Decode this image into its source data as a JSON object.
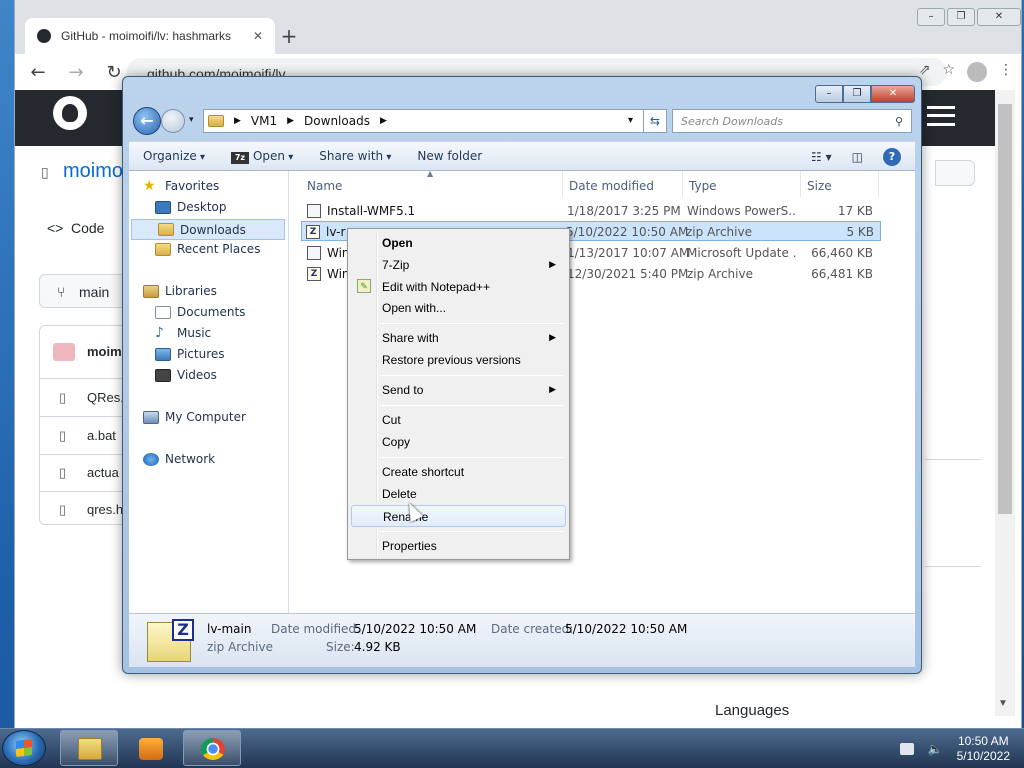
{
  "browser": {
    "tab_title": "GitHub - moimoifi/lv: hashmarks",
    "tab_close": "✕",
    "new_tab": "+",
    "url": "github.com/moimoifi/lv",
    "window_buttons": [
      "–",
      "❐",
      "✕"
    ]
  },
  "github": {
    "repo_owner": "moimo",
    "tab_code": "Code",
    "branch": "main",
    "commit_user": "moim",
    "files": [
      "QRes.",
      "a.bat",
      "actua",
      "qres.h"
    ],
    "languages": "Languages"
  },
  "explorer": {
    "window_buttons": [
      "–",
      "❐",
      "✕"
    ],
    "breadcrumb": [
      "VM1",
      "Downloads"
    ],
    "search_placeholder": "Search Downloads",
    "toolbar": {
      "organize": "Organize",
      "open": "Open",
      "open_icon": "7z",
      "share_with": "Share with",
      "new_folder": "New folder"
    },
    "nav": [
      {
        "label": "Favorites",
        "icon": "star"
      },
      {
        "label": "Desktop",
        "icon": "desk"
      },
      {
        "label": "Downloads",
        "icon": "fold",
        "selected": true
      },
      {
        "label": "Recent Places",
        "icon": "fold"
      },
      {
        "label": "Libraries",
        "icon": "lib"
      },
      {
        "label": "Documents",
        "icon": "doc"
      },
      {
        "label": "Music",
        "icon": "music"
      },
      {
        "label": "Pictures",
        "icon": "pic"
      },
      {
        "label": "Videos",
        "icon": "vid"
      },
      {
        "label": "My Computer",
        "icon": "comp"
      },
      {
        "label": "Network",
        "icon": "net"
      }
    ],
    "columns": [
      "Name",
      "Date modified",
      "Type",
      "Size"
    ],
    "files": [
      {
        "name": "Install-WMF5.1",
        "date": "1/18/2017 3:25 PM",
        "type": "Windows PowerS...",
        "size": "17 KB",
        "icon": "ps"
      },
      {
        "name": "lv-main",
        "name_visible": "lv-r",
        "date": "5/10/2022 10:50 AM",
        "type": "zip Archive",
        "size": "5 KB",
        "icon": "zip",
        "selected": true
      },
      {
        "name": "Win",
        "date": "1/13/2017 10:07 AM",
        "type": "Microsoft Update ...",
        "size": "66,460 KB",
        "icon": "msu"
      },
      {
        "name": "Win",
        "date": "12/30/2021 5:40 PM",
        "type": "zip Archive",
        "size": "66,481 KB",
        "icon": "zip"
      }
    ],
    "details": {
      "name": "lv-main",
      "type": "zip Archive",
      "date_modified_label": "Date modified:",
      "date_modified": "5/10/2022 10:50 AM",
      "size_label": "Size:",
      "size": "4.92 KB",
      "date_created_label": "Date created:",
      "date_created": "5/10/2022 10:50 AM"
    }
  },
  "context_menu": {
    "items": [
      {
        "label": "Open",
        "bold": true
      },
      {
        "label": "7-Zip",
        "submenu": true
      },
      {
        "label": "Edit with Notepad++",
        "icon": true
      },
      {
        "label": "Open with..."
      },
      {
        "separator": true
      },
      {
        "label": "Share with",
        "submenu": true
      },
      {
        "label": "Restore previous versions"
      },
      {
        "separator": true
      },
      {
        "label": "Send to",
        "submenu": true
      },
      {
        "separator": true
      },
      {
        "label": "Cut"
      },
      {
        "label": "Copy"
      },
      {
        "separator": true
      },
      {
        "label": "Create shortcut"
      },
      {
        "label": "Delete"
      },
      {
        "label": "Rename",
        "hover": true
      },
      {
        "separator": true
      },
      {
        "label": "Properties"
      }
    ]
  },
  "taskbar": {
    "time": "10:50 AM",
    "date": "5/10/2022"
  }
}
